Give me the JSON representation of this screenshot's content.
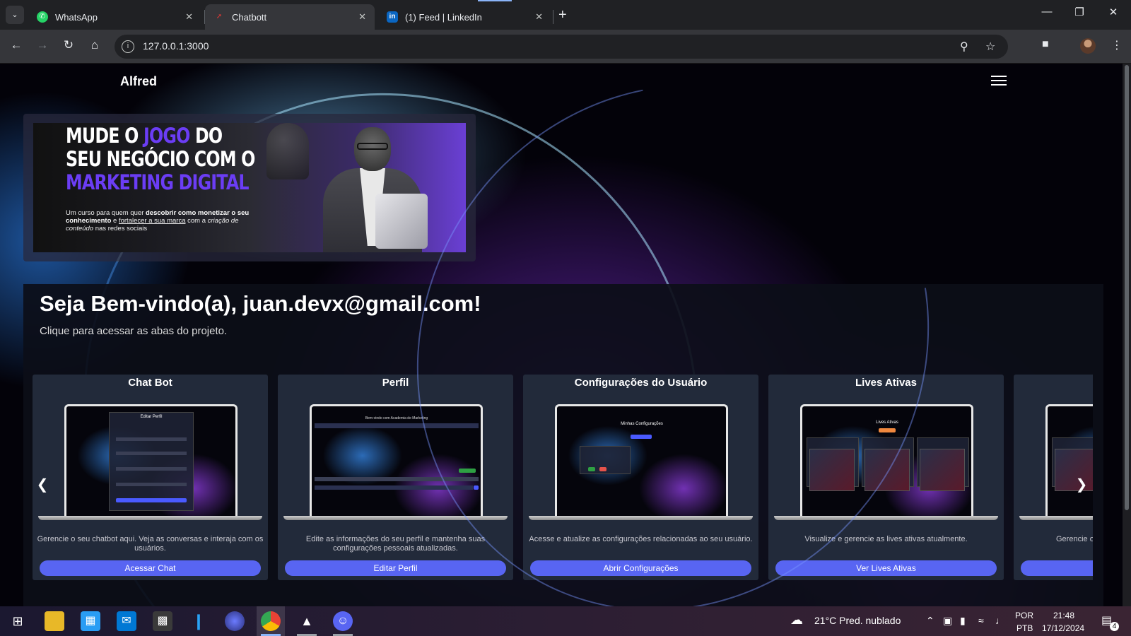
{
  "browser": {
    "tabs": [
      {
        "label": "WhatsApp",
        "icon": "whatsapp-icon",
        "active": false
      },
      {
        "label": "Chatbott",
        "icon": "chatbot-favicon-icon",
        "active": true
      },
      {
        "label": "(1) Feed | LinkedIn",
        "icon": "linkedin-icon",
        "active": false
      }
    ],
    "url": "127.0.0.1:3000",
    "accent": "#8ab4f8"
  },
  "app": {
    "brand": "Alfred",
    "banner": {
      "line1_a": "MUDE O ",
      "line1_b": "JOGO",
      "line1_c": " DO",
      "line2": "SEU NEGÓCIO COM O",
      "line3": "MARKETING DIGITAL",
      "sub_a": "Um curso para quem quer ",
      "sub_b": "descobrir como monetizar o seu conhecimento",
      "sub_c": " e ",
      "sub_d": "fortalecer a sua marca",
      "sub_e": " com a ",
      "sub_f": "criação de conteúdo",
      "sub_g": " nas redes sociais"
    },
    "welcome": "Seja Bem-vindo(a), juan.devx@gmail.com!",
    "welcome_sub": "Clique para acessar as abas do projeto.",
    "button_color": "#5865f2",
    "cards": [
      {
        "title": "Chat Bot",
        "desc": "Gerencie o seu chatbot aqui. Veja as conversas e interaja com os usuários.",
        "button": "Acessar Chat",
        "shot_label": "Editar Perfil"
      },
      {
        "title": "Perfil",
        "desc": "Edite as informações do seu perfil e mantenha suas configurações pessoais atualizadas.",
        "button": "Editar Perfil",
        "shot_label": "Bem-vindo com Academia de Marketing"
      },
      {
        "title": "Configurações do Usuário",
        "desc": "Acesse e atualize as configurações relacionadas ao seu usuário.",
        "button": "Abrir Configurações",
        "shot_label": "Minhas Configurações"
      },
      {
        "title": "Lives Ativas",
        "desc": "Visualize e gerencie as lives ativas atualmente.",
        "button": "Ver Lives Ativas",
        "shot_label": "Lives Ativas"
      },
      {
        "title": "",
        "desc": "Gerencie o",
        "button": "",
        "shot_label": ""
      }
    ]
  },
  "taskbar": {
    "weather": "21°C Pred. nublado",
    "lang_top": "POR",
    "lang_bottom": "PTB",
    "time": "21:48",
    "date": "17/12/2024",
    "notifications": "4"
  }
}
